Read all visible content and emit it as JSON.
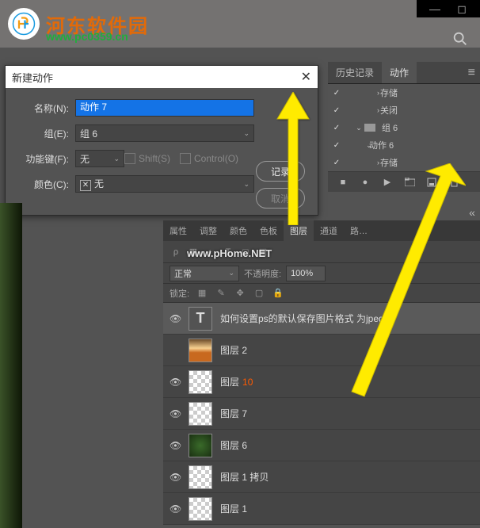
{
  "header": {
    "site_name": "河东软件园",
    "site_url": "www.pc0359.cn"
  },
  "dialog": {
    "title": "新建动作",
    "name_label": "名称(N):",
    "name_value": "动作 7",
    "group_label": "组(E):",
    "group_value": "组 6",
    "fkey_label": "功能键(F):",
    "fkey_value": "无",
    "shift": "Shift(S)",
    "control": "Control(O)",
    "color_label": "颜色(C):",
    "color_value": "无",
    "record_btn": "记录",
    "cancel_btn": "取消"
  },
  "action_panel": {
    "tab_history": "历史记录",
    "tab_actions": "动作",
    "rows": [
      {
        "label": "存储"
      },
      {
        "label": "关闭"
      },
      {
        "label": "组 6"
      },
      {
        "label": "动作 6"
      },
      {
        "label": "存储"
      }
    ]
  },
  "props_panel": {
    "tabs": [
      "属性",
      "调整",
      "颜色",
      "色板",
      "图层",
      "通道",
      "路…"
    ],
    "mode": "正常",
    "opacity_label": "不透明度:",
    "opacity_value": "100%",
    "lock_label": "锁定:"
  },
  "layers": [
    {
      "eye": true,
      "type": "text",
      "name": "如何设置ps的默认保存图片格式 为jpeg?",
      "active": true
    },
    {
      "eye": false,
      "type": "img1",
      "name": "图层 2"
    },
    {
      "eye": true,
      "type": "checker",
      "name": "图层",
      "suffix": "10"
    },
    {
      "eye": true,
      "type": "checker",
      "name": "图层 7"
    },
    {
      "eye": true,
      "type": "green",
      "name": "图层 6"
    },
    {
      "eye": true,
      "type": "checker",
      "name": "图层 1 拷贝"
    },
    {
      "eye": true,
      "type": "checker",
      "name": "图层 1"
    }
  ],
  "watermark": "www.pHome.NET"
}
